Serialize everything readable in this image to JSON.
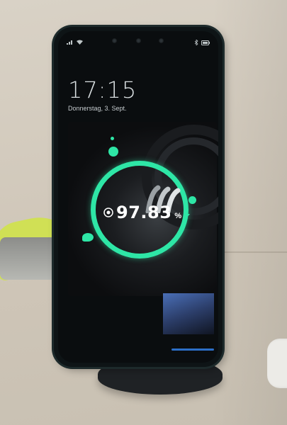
{
  "status_bar": {
    "left_icons": [
      "signal-icon",
      "wifi-icon"
    ],
    "right_icons": [
      "bluetooth-icon",
      "battery-icon"
    ]
  },
  "lock_screen": {
    "time": "17:15",
    "date": "Donnerstag, 3. Sept."
  },
  "charging": {
    "percent": "97.83",
    "unit": "%",
    "icons": [
      "wireless-charging-icon",
      "lightning-icon"
    ]
  },
  "colors": {
    "accent": "#2ee6a6",
    "card_blue": "#4a6fb7",
    "nav_blue": "#2c6ec7"
  }
}
